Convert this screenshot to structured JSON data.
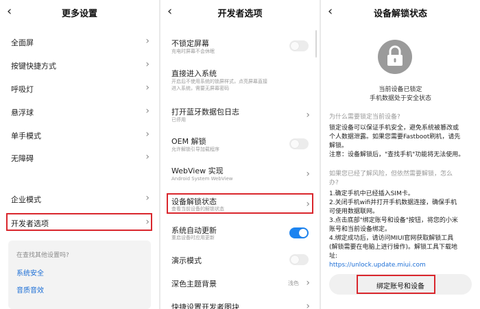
{
  "panel1": {
    "title": "更多设置",
    "items": [
      {
        "label": "全面屏"
      },
      {
        "label": "按键快捷方式"
      },
      {
        "label": "呼吸灯"
      },
      {
        "label": "悬浮球"
      },
      {
        "label": "单手模式"
      },
      {
        "label": "无障碍"
      },
      {
        "label": "企业模式"
      },
      {
        "label": "开发者选项"
      }
    ],
    "search_card": {
      "question": "在查找其他设置吗?",
      "links": [
        "系统安全",
        "音质音效"
      ]
    }
  },
  "panel2": {
    "title": "开发者选项",
    "items": [
      {
        "label": "不锁定屏幕",
        "sub": "充电时屏幕不会休眠",
        "toggle": "off"
      },
      {
        "label": "直接进入系统",
        "sub1": "开启后不使用系统的锁屏样式，点亮屏幕直接",
        "sub2": "进入系统，需要无屏幕密码"
      },
      {
        "label": "打开蓝牙数据包日志",
        "sub": "已停用"
      },
      {
        "label": "OEM 解锁",
        "sub": "允许解锁引导加载程序",
        "toggle": "off"
      },
      {
        "label": "WebView 实现",
        "sub": "Android System WebView"
      },
      {
        "label": "设备解锁状态",
        "sub": "查看当前设备的解锁状态"
      },
      {
        "label": "系统自动更新",
        "sub": "重启设备时应用更新",
        "toggle": "on"
      },
      {
        "label": "演示模式",
        "toggle": "off"
      },
      {
        "label": "深色主题背景",
        "value": "浅色"
      },
      {
        "label": "快捷设置开发者图块"
      }
    ]
  },
  "panel3": {
    "title": "设备解锁状态",
    "status_line1": "当前设备已锁定",
    "status_line2": "手机数据处于安全状态",
    "why_question": "为什么需要锁定当前设备?",
    "why_l1": "锁定设备可以保证手机安全，避免系统被篡改或",
    "why_l2": "个人数据泄露。如果您需要Fastboot刷机，请先",
    "why_l3": "解锁。",
    "why_l4": "注意：设备解锁后，\"查找手机\"功能将无法使用。",
    "q2_l1": "如果您已经了解风险，但依然需要解锁，怎么",
    "q2_l2": "办?",
    "steps": [
      "1.确定手机中已经插入SIM卡。",
      "2.关闭手机wifi并打开手机数据连接，确保手机",
      "可使用数据联网。",
      "3.点击底部\"绑定账号和设备\"按钮，将您的小米",
      "账号和当前设备绑定。",
      "4.绑定成功后，请访问MIUI官网获取解锁工具",
      "(解锁需要在电脑上进行操作)。解锁工具下载地",
      "址:"
    ],
    "url": "https://unlock.update.miui.com",
    "bind_button": "绑定账号和设备"
  },
  "colors": {
    "accent": "#1d84f0",
    "highlight": "#d9262c",
    "link": "#1d6fd6"
  },
  "icons": {
    "back": "back-arrow-icon",
    "chevron": "chevron-right-icon",
    "lock": "lock-icon"
  }
}
